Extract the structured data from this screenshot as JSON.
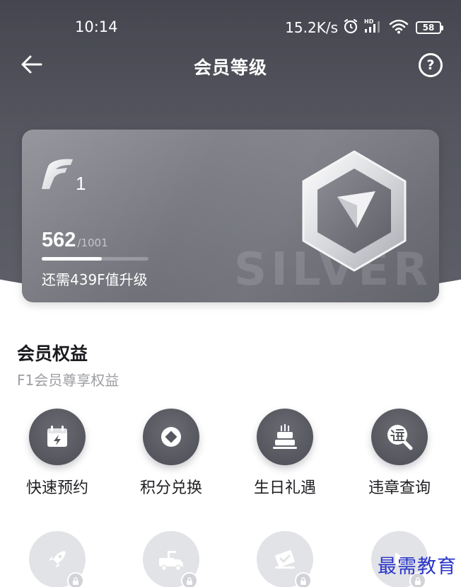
{
  "status_bar": {
    "time": "10:14",
    "network_speed": "15.2K/s",
    "network_badge": "HD",
    "battery_level": "58",
    "icons": [
      "alarm-icon",
      "signal-icon",
      "wifi-icon",
      "battery-icon"
    ]
  },
  "nav": {
    "title": "会员等级",
    "back_icon": "arrow-left-icon",
    "help_label": "?"
  },
  "member_card": {
    "level_letter": "F",
    "level_number": "1",
    "watermark_text": "SILVER",
    "score_current": "562",
    "score_total": "/1001",
    "progress_fraction": 0.561,
    "upgrade_hint": "还需439F值升级",
    "badge_icon": "hexagon-arrow-badge-icon"
  },
  "benefits": {
    "title": "会员权益",
    "subtitle": "F1会员尊享权益",
    "items": [
      {
        "label": "快速预约",
        "icon": "calendar-bolt-icon",
        "locked": false
      },
      {
        "label": "积分兑换",
        "icon": "coin-icon",
        "locked": false
      },
      {
        "label": "生日礼遇",
        "icon": "birthday-cake-icon",
        "locked": false
      },
      {
        "label": "违章查询",
        "icon": "violation-search-icon",
        "locked": false
      },
      {
        "label": "",
        "icon": "rocket-icon",
        "locked": true
      },
      {
        "label": "",
        "icon": "tow-truck-icon",
        "locked": true
      },
      {
        "label": "",
        "icon": "ticket-check-icon",
        "locked": true
      },
      {
        "label": "",
        "icon": "play-icon",
        "locked": true
      }
    ]
  },
  "watermark": "最需教育",
  "colors": {
    "header_bg": "#4a4b54",
    "card_bg": "#7a7b83",
    "benefit_icon_bg": "#5a5b63",
    "locked_icon_bg": "#e2e3e6",
    "subtitle_text": "#9d9ea4",
    "watermark_text": "#2a35c9"
  }
}
